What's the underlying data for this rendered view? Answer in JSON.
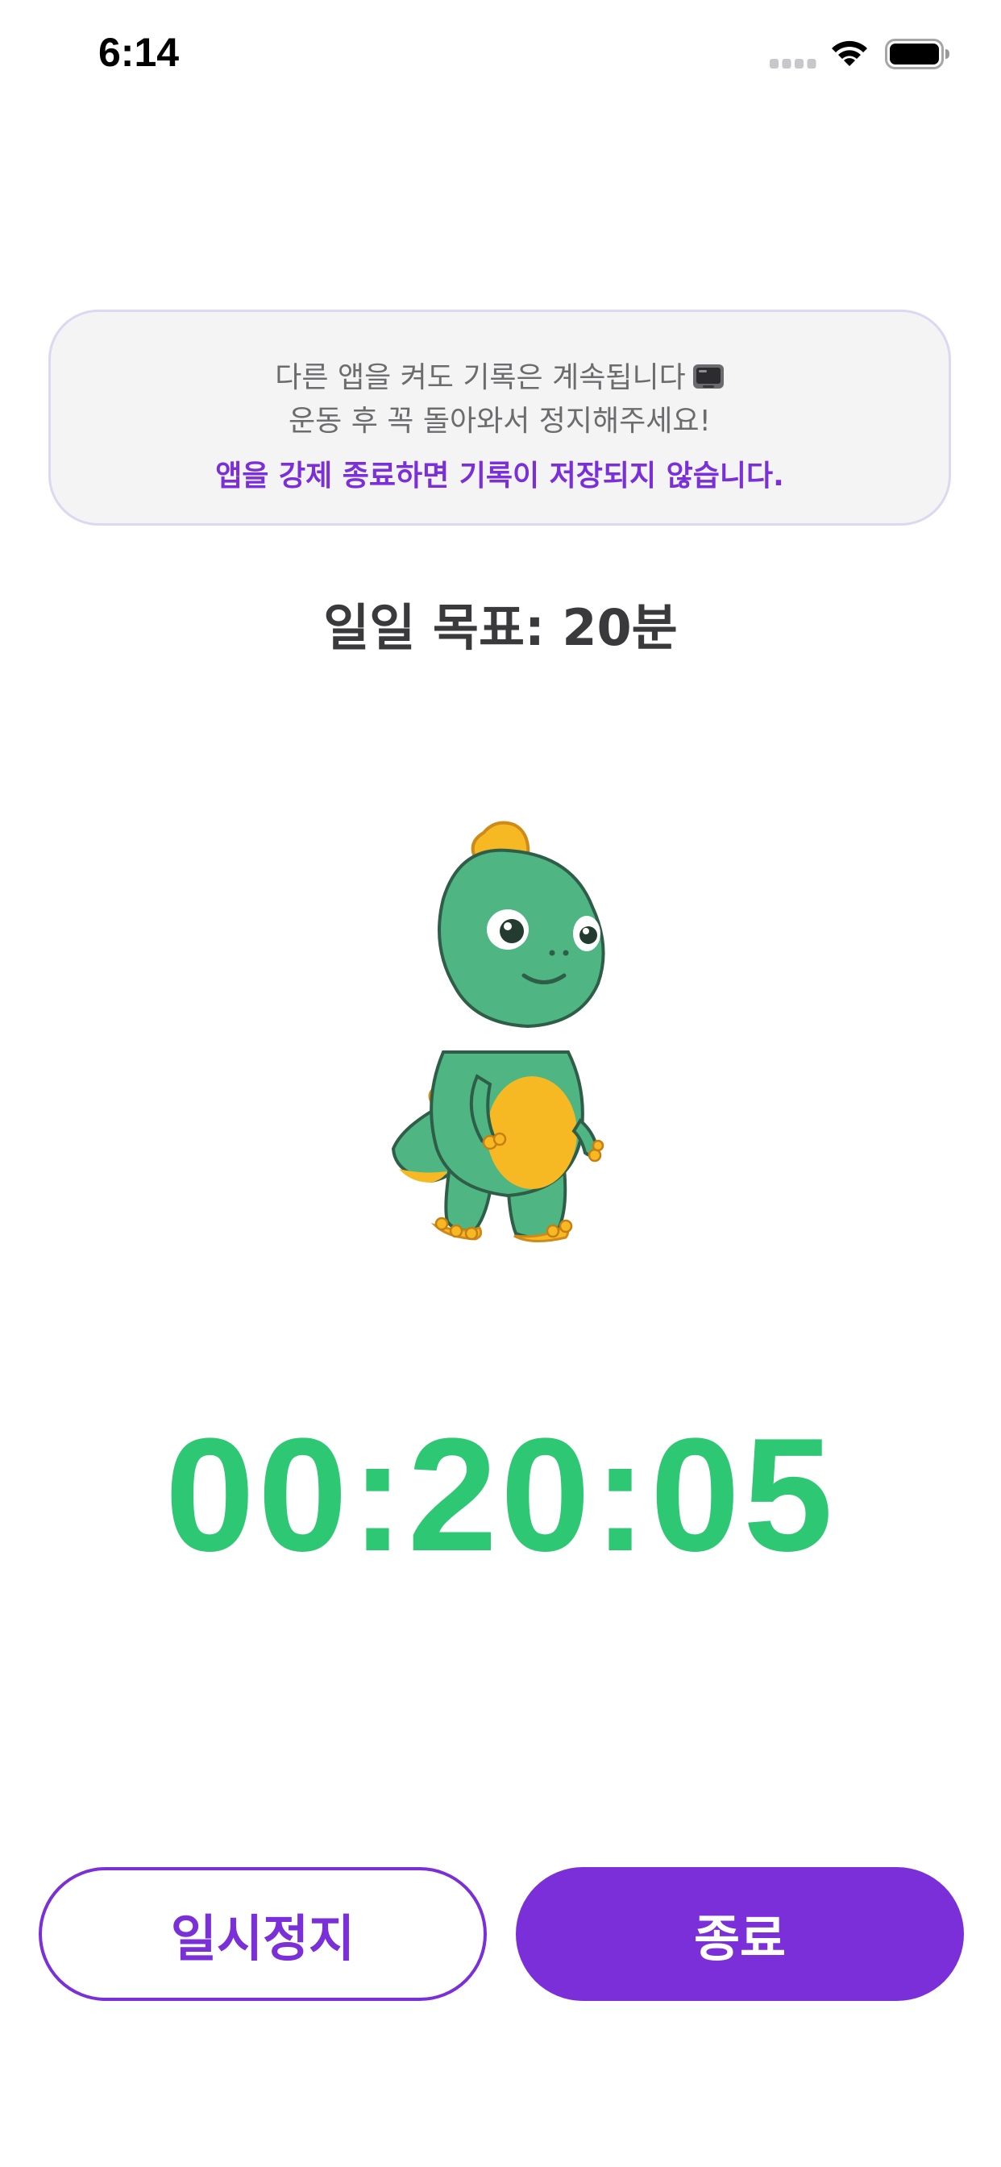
{
  "status_bar": {
    "time": "6:14",
    "icons": [
      "signal-icon",
      "wifi-icon",
      "battery-icon"
    ]
  },
  "notice": {
    "line1": "다른 앱을 켜도 기록은 계속됩니다",
    "line1_icon": "television-icon",
    "line2": "운동 후 꼭 돌아와서 정지해주세요!",
    "warning": "앱을 강제 종료하면 기록이 저장되지 않습니다."
  },
  "goal": {
    "title": "일일 목표: 20분"
  },
  "mascot": {
    "icon": "dinosaur-mascot"
  },
  "timer": {
    "value": "00:20:05"
  },
  "buttons": {
    "pause_label": "일시정지",
    "end_label": "종료"
  },
  "colors": {
    "accent": "#7b2fd9",
    "timer": "#2ec875",
    "card_bg": "#f4f4f5",
    "card_border": "#ddd7f1"
  }
}
